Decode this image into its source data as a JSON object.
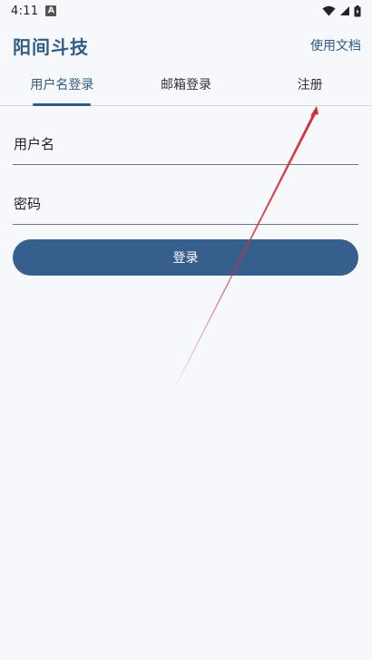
{
  "status_bar": {
    "time": "4:11",
    "notification_icon": "a-icon",
    "icons": [
      "wifi-icon",
      "signal-icon",
      "battery-icon"
    ]
  },
  "header": {
    "title": "阳间斗技",
    "docs_link": "使用文档"
  },
  "tabs": [
    {
      "label": "用户名登录",
      "active": true
    },
    {
      "label": "邮箱登录",
      "active": false
    },
    {
      "label": "注册",
      "active": false
    }
  ],
  "form": {
    "username_placeholder": "用户名",
    "password_placeholder": "密码",
    "login_label": "登录"
  },
  "colors": {
    "primary": "#2f5b86",
    "button": "#365f8e",
    "background": "#f6f8fb",
    "annotation_arrow": "#d0303a"
  }
}
